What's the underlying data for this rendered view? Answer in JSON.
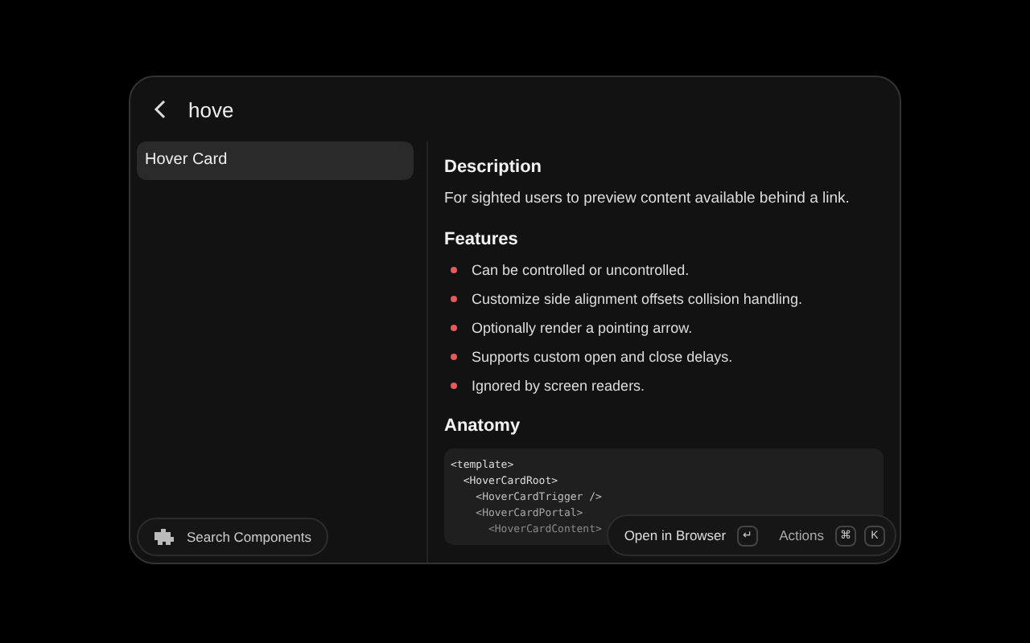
{
  "search": {
    "value": "hove"
  },
  "results": [
    {
      "label": "Hover Card",
      "selected": true
    }
  ],
  "detail": {
    "sections": [
      {
        "kind": "text",
        "heading": "Description",
        "text": "For sighted users to preview content available behind a link."
      },
      {
        "kind": "list",
        "heading": "Features",
        "items": [
          "Can be controlled or uncontrolled.",
          "Customize side alignment offsets collision handling.",
          "Optionally render a pointing arrow.",
          "Supports custom open and close delays.",
          "Ignored by screen readers."
        ]
      },
      {
        "kind": "code",
        "heading": "Anatomy",
        "lines": [
          "<template>",
          "  <HoverCardRoot>",
          "    <HoverCardTrigger />",
          "    <HoverCardPortal>",
          "      <HoverCardContent>"
        ]
      }
    ]
  },
  "footer": {
    "search_button": "Search Components",
    "open_button": "Open in Browser",
    "open_key": "↵",
    "actions_button": "Actions",
    "action_keys": [
      "⌘",
      "K"
    ]
  }
}
